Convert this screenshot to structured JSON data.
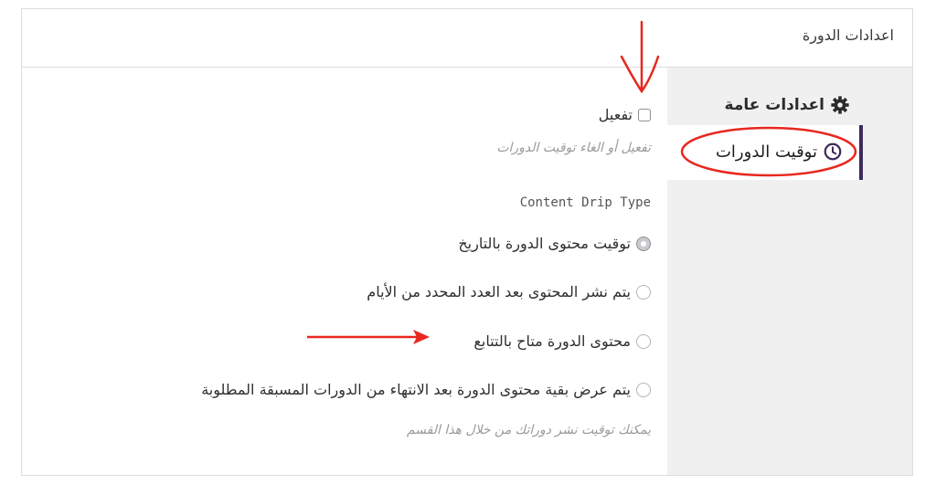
{
  "header": {
    "title": "اعدادات الدورة"
  },
  "sidebar": {
    "tabs": [
      {
        "label": "اعدادات عامة",
        "icon": "gear-icon"
      },
      {
        "label": "توقيت الدورات",
        "icon": "clock-icon",
        "active": true
      }
    ]
  },
  "content": {
    "enable": {
      "label": "تفعيل",
      "checked": false,
      "description": "تفعيل أو الغاء توقيت الدورات"
    },
    "drip_type_title": "Content Drip Type",
    "options": [
      {
        "label": "توقيت محتوى الدورة بالتاريخ",
        "selected": true
      },
      {
        "label": "يتم نشر المحتوى بعد العدد المحدد من الأيام",
        "selected": false
      },
      {
        "label": "محتوى الدورة متاح بالتتابع",
        "selected": false
      },
      {
        "label": "يتم عرض بقية محتوى الدورة بعد الانتهاء من الدورات المسبقة المطلوبة",
        "selected": false
      }
    ],
    "footer_note": "يمكنك توقيت نشر دوراتك من خلال هذا القسم"
  },
  "colors": {
    "accent": "#3c2a5c",
    "annotation": "#e8271e",
    "sidebar_bg": "#f0f0f1"
  }
}
